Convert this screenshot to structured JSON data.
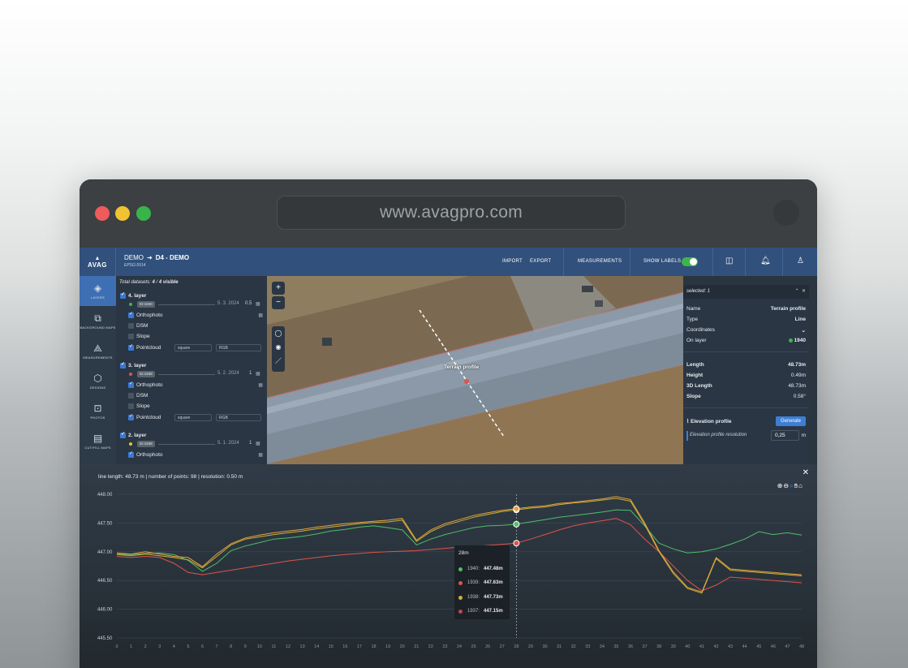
{
  "browser": {
    "url": "www.avagpro.com"
  },
  "app": {
    "logo": "AVAG",
    "breadcrumb": {
      "project": "DEMO",
      "dataset": "D4 - DEMO",
      "sub": "EPSG:5514"
    },
    "topnav": {
      "import": "IMPORT",
      "export": "EXPORT",
      "measurements": "MEASUREMENTS",
      "show_labels": "SHOW LABELS",
      "show_labels_on": true
    }
  },
  "sidebar": {
    "items": [
      {
        "label": "LAYERS",
        "icon": "layers-icon",
        "active": true
      },
      {
        "label": "BACKGROUND MAPS",
        "icon": "background-maps-icon"
      },
      {
        "label": "MEASUREMENTS",
        "icon": "measure-icon"
      },
      {
        "label": "DESIGNS",
        "icon": "designs-icon"
      },
      {
        "label": "PHOTOS",
        "icon": "photos-icon"
      },
      {
        "label": "CUT/FILL MAPS",
        "icon": "cutfill-icon"
      }
    ]
  },
  "layers_panel": {
    "header_prefix": "Total datasets:",
    "count": "4",
    "sep": "/",
    "visible": "4 visible",
    "layers": [
      {
        "title": "4. layer",
        "id": "ID:1940",
        "date": "5. 3. 2024",
        "scale": "0.5",
        "dot_color": "#3fb44a",
        "sublayers": [
          {
            "label": "Orthophoto",
            "checked": true
          },
          {
            "label": "DSM",
            "checked": false
          },
          {
            "label": "Slope",
            "checked": false
          },
          {
            "label": "Pointcloud",
            "checked": true,
            "shape": "square",
            "color": "RGB"
          }
        ]
      },
      {
        "title": "3. layer",
        "id": "ID:1939",
        "date": "5. 2. 2024",
        "scale": "1",
        "dot_color": "#e0534a",
        "sublayers": [
          {
            "label": "Orthophoto",
            "checked": true
          },
          {
            "label": "DSM",
            "checked": false
          },
          {
            "label": "Slope",
            "checked": false
          },
          {
            "label": "Pointcloud",
            "checked": true,
            "shape": "square",
            "color": "RGB"
          }
        ]
      },
      {
        "title": "2. layer",
        "id": "ID:1938",
        "date": "5. 1. 2024",
        "scale": "1",
        "dot_color": "#e8c13a",
        "sublayers": [
          {
            "label": "Orthophoto",
            "checked": true
          }
        ]
      }
    ]
  },
  "map": {
    "profile_label": "Terrain profile"
  },
  "properties": {
    "header": "selected: 1",
    "name_k": "Name",
    "name_v": "Terrain profile",
    "type_k": "Type",
    "type_v": "Line",
    "coords_k": "Coordinates",
    "layer_k": "On layer",
    "layer_v": "1940",
    "length_k": "Length",
    "length_v": "48.73m",
    "height_k": "Height",
    "height_v": "0.49m",
    "len3d_k": "3D Length",
    "len3d_v": "48.73m",
    "slope_k": "Slope",
    "slope_v": "0.58°",
    "elev_title": "Elevation profile",
    "generate": "Generate",
    "res_label": "Elevation profile resolution",
    "res_value": "0,25",
    "res_unit": "m"
  },
  "chart_info": "line length: 48.73 m | number of points: 98 | resolution: 0.50 m",
  "chart_data": {
    "type": "line",
    "ylim": [
      445.5,
      448.0
    ],
    "xlim": [
      0,
      48
    ],
    "y_ticks": [
      "448.00",
      "447.50",
      "447.00",
      "446.50",
      "446.00",
      "445.50"
    ],
    "x": [
      0,
      1,
      2,
      3,
      4,
      5,
      6,
      7,
      8,
      9,
      10,
      11,
      12,
      13,
      14,
      15,
      16,
      17,
      18,
      19,
      20,
      21,
      22,
      23,
      24,
      25,
      26,
      27,
      28,
      29,
      30,
      31,
      32,
      33,
      34,
      35,
      36,
      37,
      38,
      39,
      40,
      41,
      42,
      43,
      44,
      45,
      46,
      47,
      48
    ],
    "series": [
      {
        "name": "1940",
        "color": "#4fbf6a",
        "values": [
          446.96,
          446.95,
          446.97,
          446.98,
          446.95,
          446.85,
          446.66,
          446.8,
          447.02,
          447.1,
          447.16,
          447.22,
          447.24,
          447.27,
          447.31,
          447.36,
          447.39,
          447.43,
          447.45,
          447.42,
          447.38,
          447.12,
          447.22,
          447.3,
          447.36,
          447.42,
          447.45,
          447.46,
          447.48,
          447.52,
          447.56,
          447.6,
          447.63,
          447.66,
          447.69,
          447.73,
          447.72,
          447.45,
          447.15,
          447.05,
          446.98,
          447.0,
          447.05,
          447.13,
          447.22,
          447.35,
          447.3,
          447.33,
          447.29
        ]
      },
      {
        "name": "1939",
        "color": "#e0534a",
        "values": [
          446.92,
          446.9,
          446.92,
          446.9,
          446.8,
          446.64,
          446.6,
          446.64,
          446.68,
          446.72,
          446.76,
          446.8,
          446.84,
          446.87,
          446.9,
          446.93,
          446.95,
          446.97,
          446.99,
          447.0,
          447.01,
          447.02,
          447.04,
          447.06,
          447.08,
          447.09,
          447.11,
          447.13,
          447.15,
          447.22,
          447.3,
          447.38,
          447.45,
          447.5,
          447.54,
          447.58,
          447.47,
          447.22,
          447.0,
          446.75,
          446.5,
          446.32,
          446.42,
          446.56,
          446.54,
          446.52,
          446.5,
          446.48,
          446.46
        ]
      },
      {
        "name": "1938",
        "color": "#c9b337",
        "values": [
          446.95,
          446.93,
          446.96,
          446.93,
          446.9,
          446.86,
          446.72,
          446.92,
          447.12,
          447.22,
          447.26,
          447.3,
          447.33,
          447.36,
          447.4,
          447.43,
          447.46,
          447.49,
          447.51,
          447.52,
          447.55,
          447.18,
          447.35,
          447.46,
          447.53,
          447.6,
          447.65,
          447.7,
          447.73,
          447.76,
          447.78,
          447.82,
          447.85,
          447.87,
          447.9,
          447.93,
          447.88,
          447.47,
          447.0,
          446.62,
          446.36,
          446.28,
          446.88,
          446.68,
          446.66,
          446.64,
          446.62,
          446.6,
          446.58
        ]
      },
      {
        "name": "1937",
        "color": "#e89f3c",
        "values": [
          446.98,
          446.96,
          447.0,
          446.96,
          446.92,
          446.9,
          446.74,
          446.96,
          447.14,
          447.24,
          447.29,
          447.33,
          447.36,
          447.39,
          447.43,
          447.46,
          447.49,
          447.51,
          447.53,
          447.55,
          447.58,
          447.2,
          447.38,
          447.49,
          447.56,
          447.63,
          447.68,
          447.72,
          447.75,
          447.78,
          447.8,
          447.84,
          447.86,
          447.89,
          447.92,
          447.96,
          447.91,
          447.5,
          447.02,
          446.65,
          446.38,
          446.3,
          446.9,
          446.7,
          446.68,
          446.66,
          446.64,
          446.62,
          446.6
        ]
      }
    ],
    "cursor_x": 28
  },
  "tooltip": {
    "title": "28m",
    "rows": [
      {
        "label": "1940:",
        "value": "447.48m",
        "color": "#4fbf6a"
      },
      {
        "label": "1939:",
        "value": "447.63m",
        "color": "#e0534a"
      },
      {
        "label": "1938:",
        "value": "447.73m",
        "color": "#c9b337"
      },
      {
        "label": "1937:",
        "value": "447.15m",
        "color": "#c04848"
      }
    ]
  }
}
